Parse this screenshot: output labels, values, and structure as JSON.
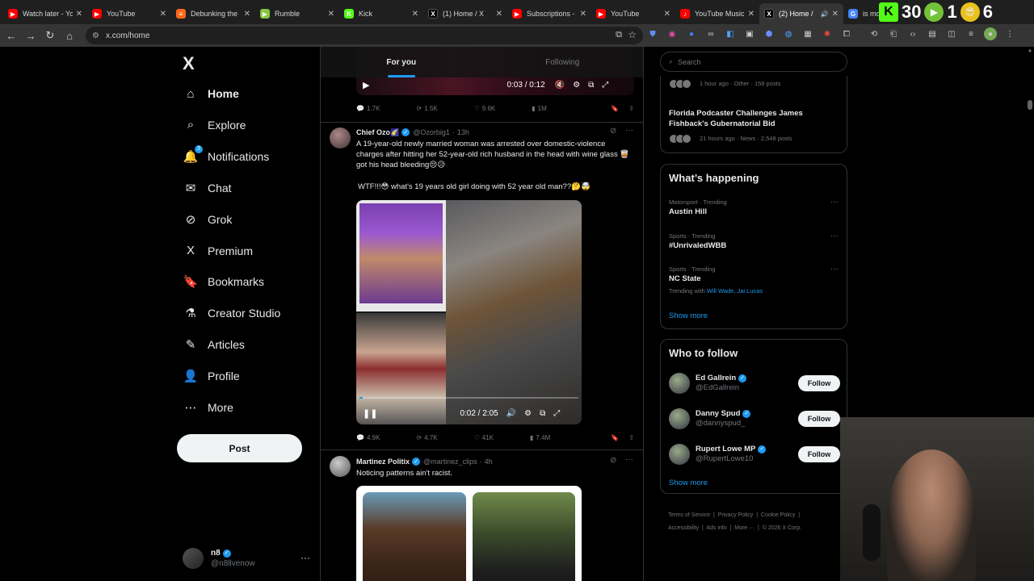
{
  "browser": {
    "tabs": [
      {
        "label": "Watch later - Yo",
        "icon": "youtube",
        "color": "#ff0000",
        "active": false
      },
      {
        "label": "YouTube",
        "icon": "youtube",
        "color": "#ff0000",
        "active": false
      },
      {
        "label": "Debunking the",
        "icon": "substack",
        "color": "#ff6719",
        "active": false
      },
      {
        "label": "Rumble",
        "icon": "rumble",
        "color": "#85c742",
        "active": false
      },
      {
        "label": "Kick",
        "icon": "kick",
        "color": "#53fc18",
        "active": false
      },
      {
        "label": "(1) Home / X",
        "icon": "x",
        "color": "#000000",
        "active": false
      },
      {
        "label": "Subscriptions -",
        "icon": "youtube",
        "color": "#ff0000",
        "active": false
      },
      {
        "label": "YouTube",
        "icon": "youtube",
        "color": "#ff0000",
        "active": false
      },
      {
        "label": "YouTube Music",
        "icon": "youtube-music",
        "color": "#ff0000",
        "active": false
      },
      {
        "label": "(2) Home /",
        "icon": "x",
        "color": "#000000",
        "active": true
      },
      {
        "label": "is moloch",
        "icon": "google",
        "color": "#4285f4",
        "active": false
      }
    ],
    "overlay": {
      "k_letter": "K",
      "count_a": "30",
      "count_b": "1",
      "count_c": "6"
    },
    "url": "x.com/home"
  },
  "sidebar": {
    "logo": "X",
    "nav": [
      {
        "label": "Home",
        "icon": "home-icon",
        "glyph": "⌂",
        "active": true
      },
      {
        "label": "Explore",
        "icon": "search-icon",
        "glyph": "⌕",
        "active": false
      },
      {
        "label": "Notifications",
        "icon": "bell-icon",
        "glyph": "🔔",
        "active": false,
        "badge": "3"
      },
      {
        "label": "Chat",
        "icon": "mail-icon",
        "glyph": "✉",
        "active": false
      },
      {
        "label": "Grok",
        "icon": "grok-icon",
        "glyph": "⊘",
        "active": false
      },
      {
        "label": "Premium",
        "icon": "x-icon",
        "glyph": "X",
        "active": false
      },
      {
        "label": "Bookmarks",
        "icon": "bookmark-icon",
        "glyph": "🔖",
        "active": false
      },
      {
        "label": "Creator Studio",
        "icon": "flask-icon",
        "glyph": "⚗",
        "active": false
      },
      {
        "label": "Articles",
        "icon": "article-icon",
        "glyph": "✎",
        "active": false
      },
      {
        "label": "Profile",
        "icon": "profile-icon",
        "glyph": "👤",
        "active": false
      },
      {
        "label": "More",
        "icon": "more-circle-icon",
        "glyph": "⋯",
        "active": false
      }
    ],
    "post_label": "Post",
    "account": {
      "name": "n8",
      "handle": "@n8llvenow"
    }
  },
  "feed": {
    "tabs": [
      {
        "label": "For you",
        "active": true
      },
      {
        "label": "Following",
        "active": false
      }
    ],
    "top_video": {
      "time": "0:03 / 0:12"
    },
    "top_actions": {
      "replies": "1.7K",
      "reposts": "1.5K",
      "likes": "9.6K",
      "views": "1M"
    },
    "tweet1": {
      "name": "Chief Ozo🌠",
      "handle": "@Ozorbig1",
      "time": "13h",
      "text1": "A 19-year-old newly married woman was arrested over domestic-violence charges after hitting her 52-year-old rich husband in the head with wine glass 🥃 got his head bleeding😔😥",
      "text2": "WTF!!!😳 what's 19 years old girl doing with 52 year old man??🤔🤯",
      "video_time": "0:02 / 2:05",
      "progress": 0.016,
      "actions": {
        "replies": "4.9K",
        "reposts": "4.7K",
        "likes": "41K",
        "views": "7.4M"
      }
    },
    "tweet2": {
      "name": "Martinez Politix",
      "handle": "@martinez_clips",
      "time": "4h",
      "text": "Noticing patterns ain't racist."
    }
  },
  "right": {
    "search_placeholder": "Search",
    "news": [
      {
        "meta": "1 hour ago · Other · 159 posts"
      },
      {
        "title": "Florida Podcaster Challenges James Fishback's Gubernatorial Bid",
        "meta": "21 hours ago · News · 2,548 posts"
      }
    ],
    "whats_happening": {
      "title": "What’s happening",
      "trends": [
        {
          "category": "Motorsport · Trending",
          "name": "Austin Hill"
        },
        {
          "category": "Sports · Trending",
          "name": "#UnrivaledWBB"
        },
        {
          "category": "Sports · Trending",
          "name": "NC State",
          "with_label": "Trending with",
          "with_links": "Will Wade, Jai Lucas"
        }
      ],
      "show_more": "Show more"
    },
    "who_to_follow": {
      "title": "Who to follow",
      "people": [
        {
          "name": "Ed Gallrein",
          "handle": "@EdGallrein",
          "button": "Follow"
        },
        {
          "name": "Danny Spud",
          "handle": "@dannyspud_",
          "button": "Follow"
        },
        {
          "name": "Rupert Lowe MP",
          "handle": "@RupertLowe10",
          "button": "Follow"
        }
      ],
      "show_more": "Show more"
    },
    "footer": {
      "links": [
        "Terms of Service",
        "Privacy Policy",
        "Cookie Policy",
        "Accessibility",
        "Ads info",
        "More ···"
      ],
      "copyright": "© 2026 X Corp."
    }
  }
}
